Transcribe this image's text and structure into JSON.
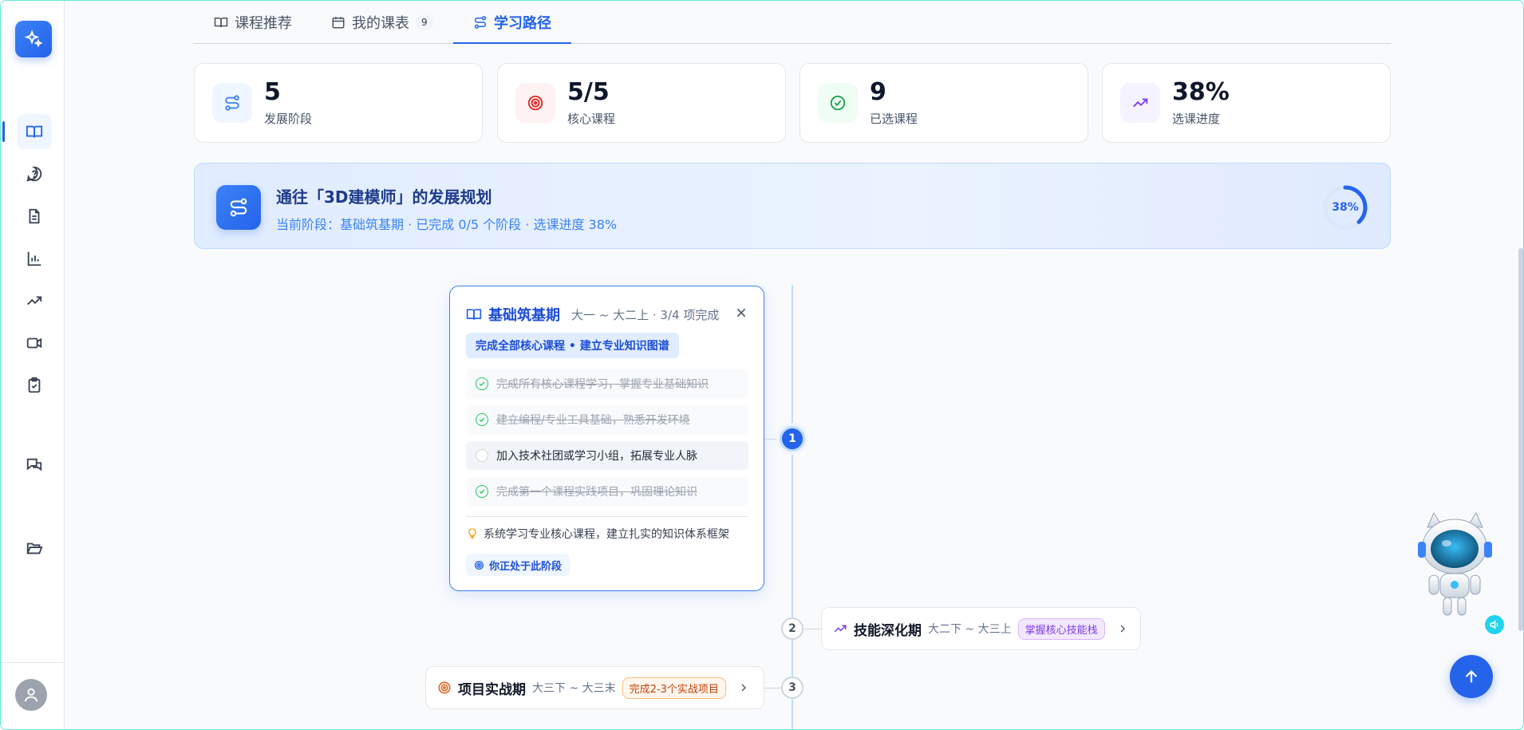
{
  "tabs": [
    {
      "label": "课程推荐",
      "icon": "book-icon"
    },
    {
      "label": "我的课表",
      "icon": "calendar-icon",
      "count": "9"
    },
    {
      "label": "学习路径",
      "icon": "route-icon",
      "active": true
    }
  ],
  "stats": [
    {
      "value": "5",
      "label": "发展阶段",
      "icon": "route-icon",
      "color": "#3b82f6"
    },
    {
      "value": "5/5",
      "label": "核心课程",
      "icon": "target-icon",
      "color": "#dc2626"
    },
    {
      "value": "9",
      "label": "已选课程",
      "icon": "check-circle-icon",
      "color": "#16a34a"
    },
    {
      "value": "38%",
      "label": "选课进度",
      "icon": "trending-up-icon",
      "color": "#7c3aed"
    }
  ],
  "banner": {
    "title": "通往「3D建模师」的发展规划",
    "subtitle": "当前阶段：基础筑基期 · 已完成 0/5 个阶段 · 选课进度 38%",
    "progress_label": "38%",
    "progress_value": 0.38
  },
  "stage1": {
    "number": "1",
    "name": "基础筑基期",
    "meta": "大一 ~ 大二上 · 3/4 项完成",
    "goal": "完成全部核心课程 • 建立专业知识图谱",
    "tasks": [
      {
        "text": "完成所有核心课程学习，掌握专业基础知识",
        "done": true
      },
      {
        "text": "建立编程/专业工具基础，熟悉开发环境",
        "done": true
      },
      {
        "text": "加入技术社团或学习小组，拓展专业人脉",
        "done": false
      },
      {
        "text": "完成第一个课程实践项目，巩固理论知识",
        "done": true
      }
    ],
    "tip": "系统学习专业核心课程，建立扎实的知识体系框架",
    "current_label": "你正处于此阶段"
  },
  "stage2": {
    "number": "2",
    "name": "技能深化期",
    "meta": "大二下 ~ 大三上",
    "badge": "掌握核心技能栈"
  },
  "stage3": {
    "number": "3",
    "name": "项目实战期",
    "meta": "大三下 ~ 大三末",
    "badge": "完成2-3个实战项目"
  },
  "colors": {
    "accent": "#2563eb",
    "stage2_badge_bg": "#f3e8ff",
    "stage2_badge_fg": "#7c3aed",
    "stage3_badge_bg": "#fff7ed",
    "stage3_badge_fg": "#c2410c"
  }
}
